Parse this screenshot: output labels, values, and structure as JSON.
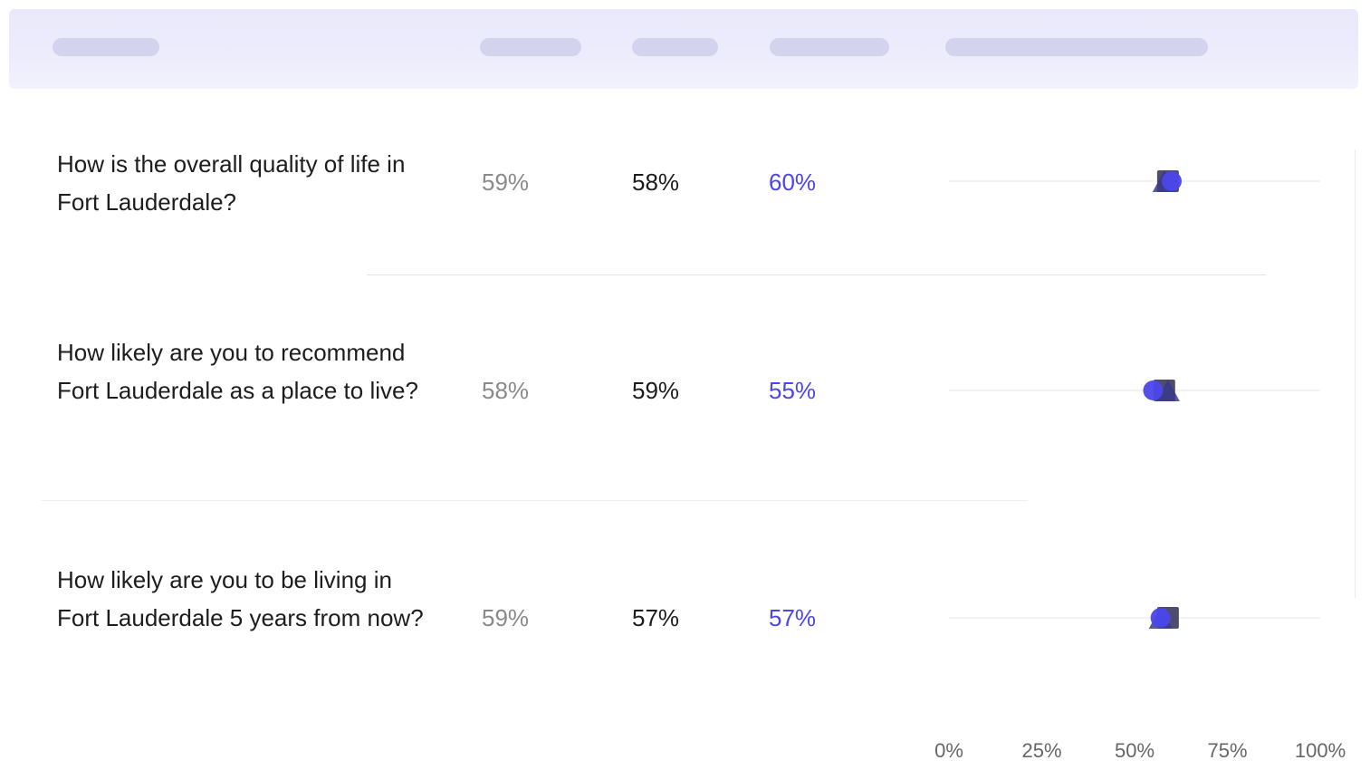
{
  "colors": {
    "accent": "#4b46ea",
    "marker_dark": "#2e2e55",
    "text": "#1d1d1d",
    "muted": "#8a8a8a"
  },
  "rows": [
    {
      "question": "How is the overall quality of life in Fort Lauderdale?",
      "v1": "59%",
      "v2": "58%",
      "v3": "60%"
    },
    {
      "question": "How likely are you to recommend Fort Lauderdale as a place to live?",
      "v1": "58%",
      "v2": "59%",
      "v3": "55%"
    },
    {
      "question": "How likely are you to be living in Fort Lauderdale 5 years from now?",
      "v1": "59%",
      "v2": "57%",
      "v3": "57%"
    }
  ],
  "chart_data": {
    "type": "scatter",
    "categories": [
      "How is the overall quality of life in Fort Lauderdale?",
      "How likely are you to recommend Fort Lauderdale as a place to live?",
      "How likely are you to be living in Fort Lauderdale 5 years from now?"
    ],
    "series": [
      {
        "values": [
          59,
          58,
          59
        ]
      },
      {
        "values": [
          58,
          59,
          57
        ]
      },
      {
        "values": [
          60,
          55,
          57
        ]
      }
    ],
    "xlim": [
      0,
      100
    ],
    "x_ticks": [
      "0%",
      "25%",
      "50%",
      "75%",
      "100%"
    ],
    "grid": false
  }
}
